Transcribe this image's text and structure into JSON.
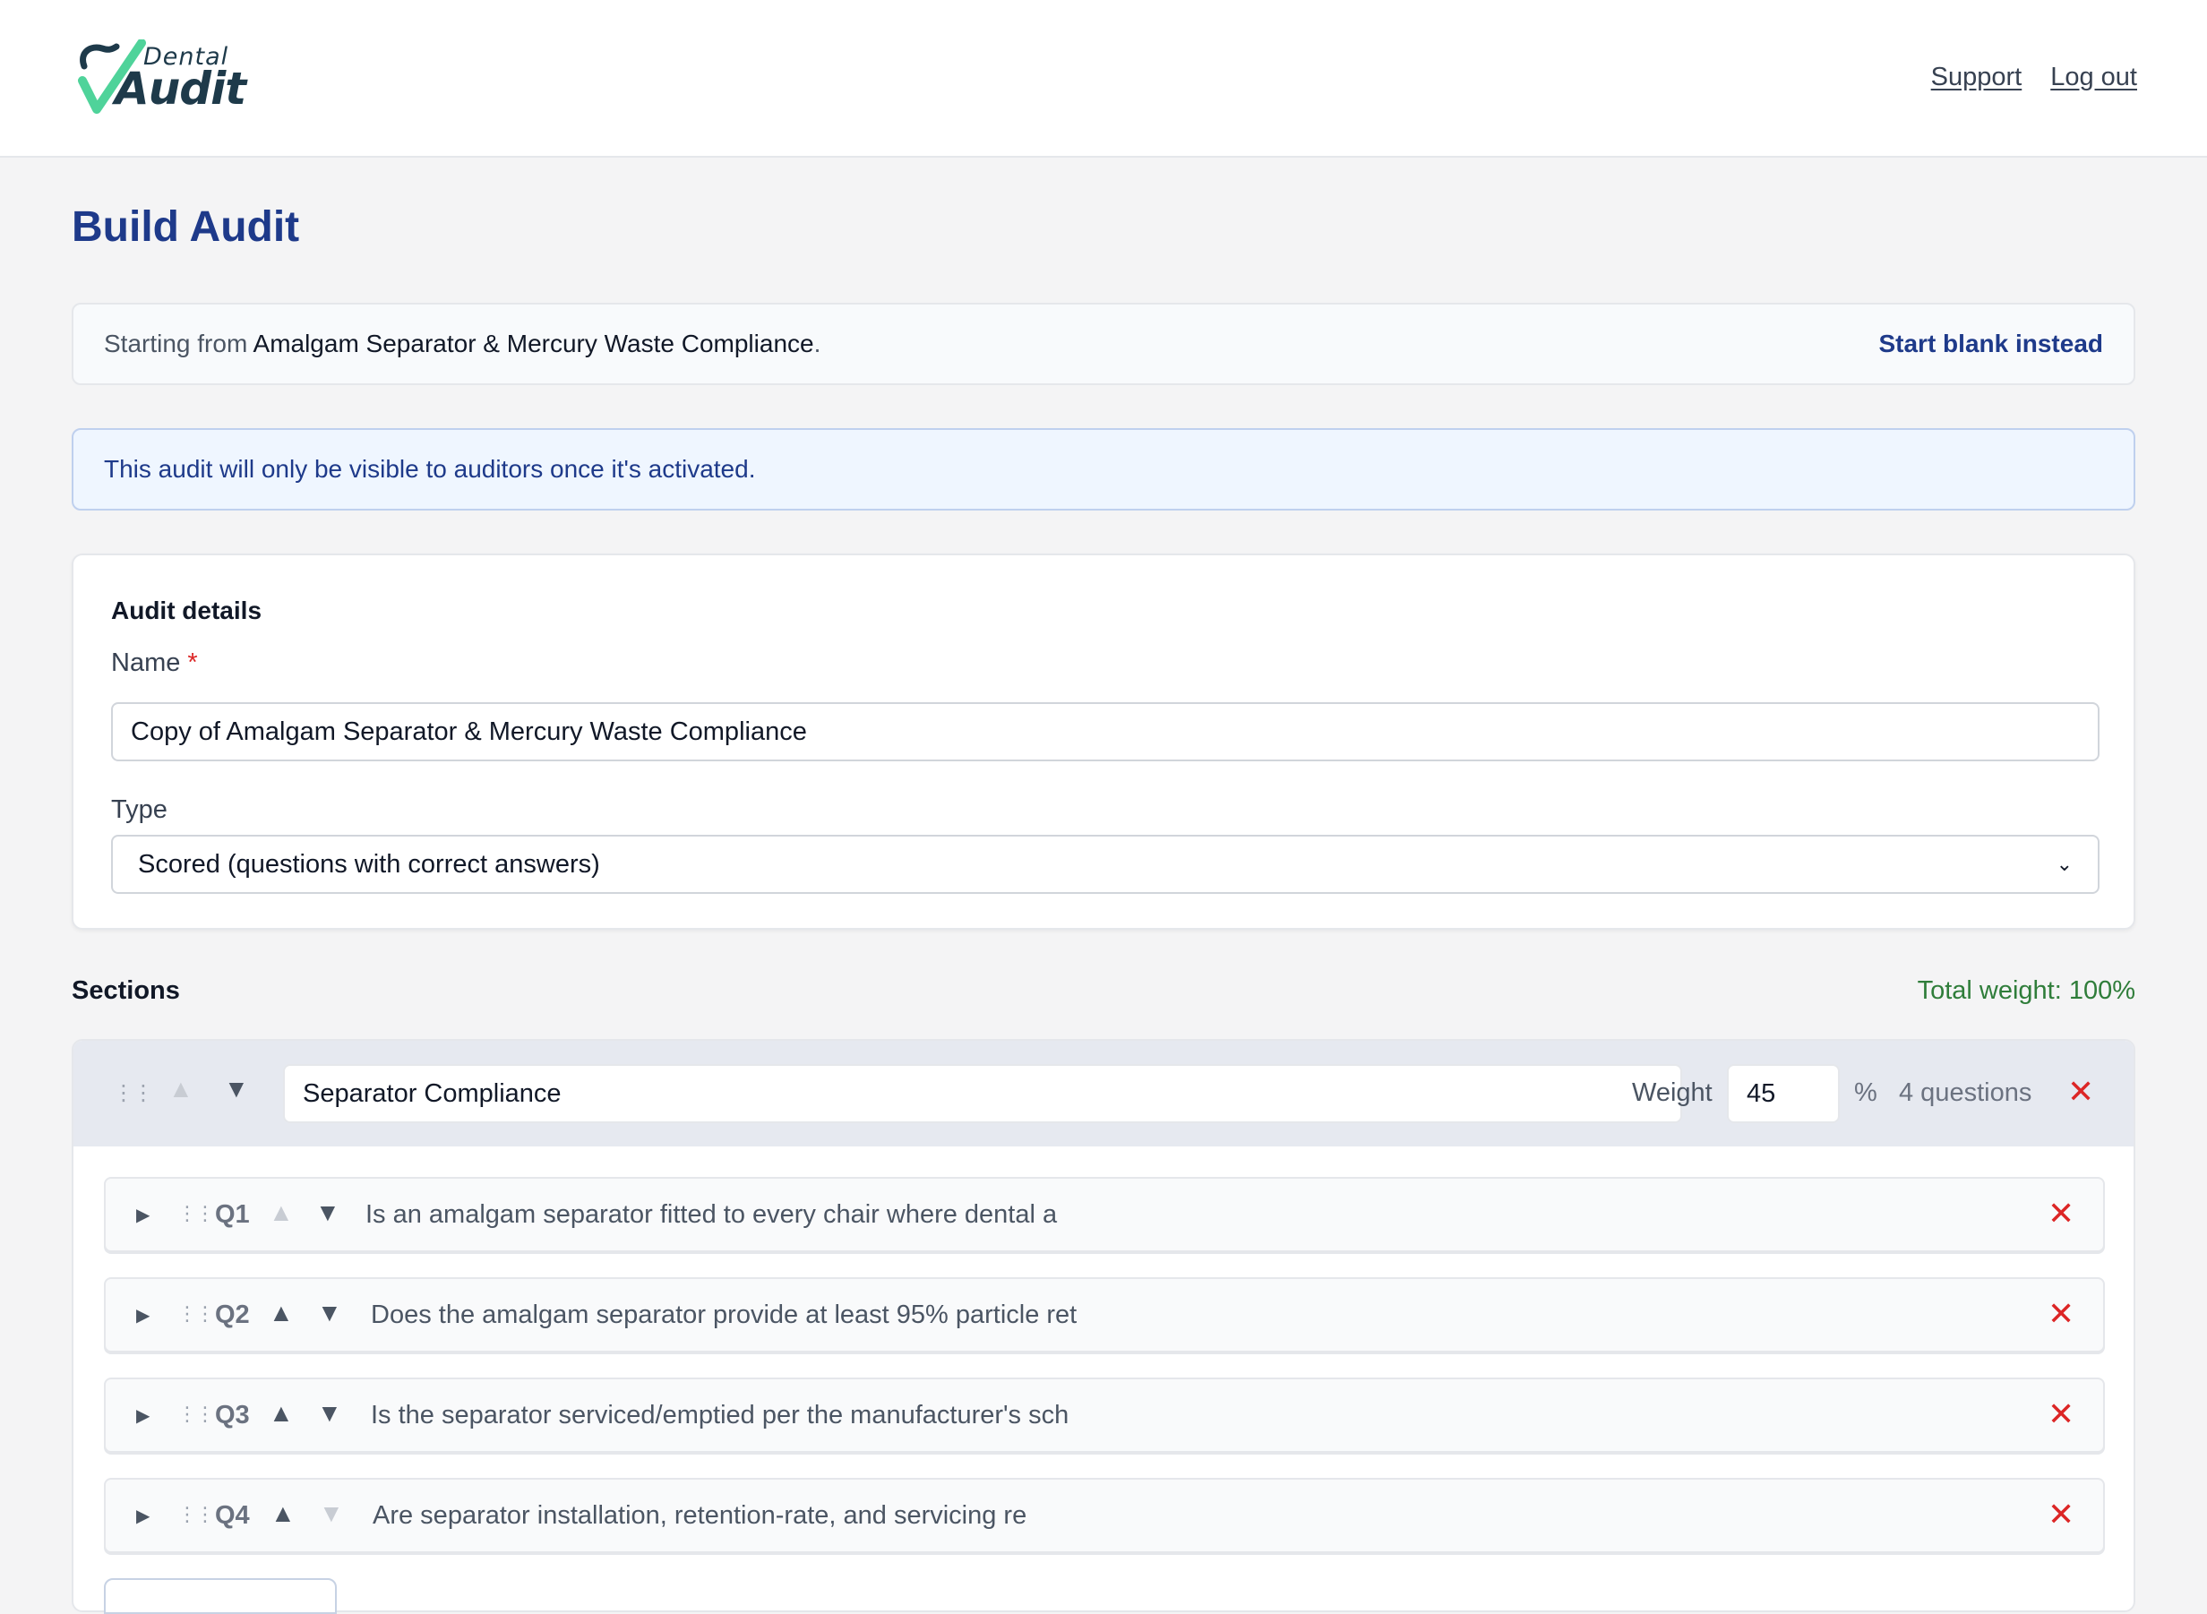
{
  "header": {
    "logo": {
      "dental": "Dental",
      "audit": "Audit"
    },
    "links": {
      "support": "Support",
      "logout": "Log out"
    }
  },
  "page": {
    "title": "Build Audit"
  },
  "source_banner": {
    "prefix": "Starting from",
    "template_name": "Amalgam Separator & Mercury Waste Compliance",
    "suffix": ".",
    "action": "Start blank instead"
  },
  "info_banner": {
    "text": "This audit will only be visible to auditors once it's activated."
  },
  "details": {
    "title": "Audit details",
    "name_label": "Name",
    "required_mark": "*",
    "name_value": "Copy of Amalgam Separator & Mercury Waste Compliance",
    "type_label": "Type",
    "type_value": "Scored (questions with correct answers)"
  },
  "sections": {
    "label": "Sections",
    "total_weight": "Total weight: 100%",
    "items": [
      {
        "name": "Separator Compliance",
        "weight_label": "Weight",
        "weight": "45",
        "percent_sign": "%",
        "question_count": "4 questions",
        "questions": [
          {
            "num": "Q1",
            "text": "Is an amalgam separator fitted to every chair where dental a"
          },
          {
            "num": "Q2",
            "text": "Does the amalgam separator provide at least 95% particle ret"
          },
          {
            "num": "Q3",
            "text": "Is the separator serviced/emptied per the manufacturer's sch"
          },
          {
            "num": "Q4",
            "text": "Are separator installation, retention-rate, and servicing re"
          }
        ]
      }
    ]
  },
  "icons": {
    "drag": "drag-handle-icon",
    "up": "arrow-up-icon",
    "down": "arrow-down-icon",
    "remove": "close-icon",
    "expand": "caret-right-icon"
  },
  "colors": {
    "primary": "#1e3a8a",
    "success": "#2f7d3a",
    "danger": "#dc2626",
    "logo_green": "#4fd39a",
    "logo_dark": "#1e3a4a"
  }
}
